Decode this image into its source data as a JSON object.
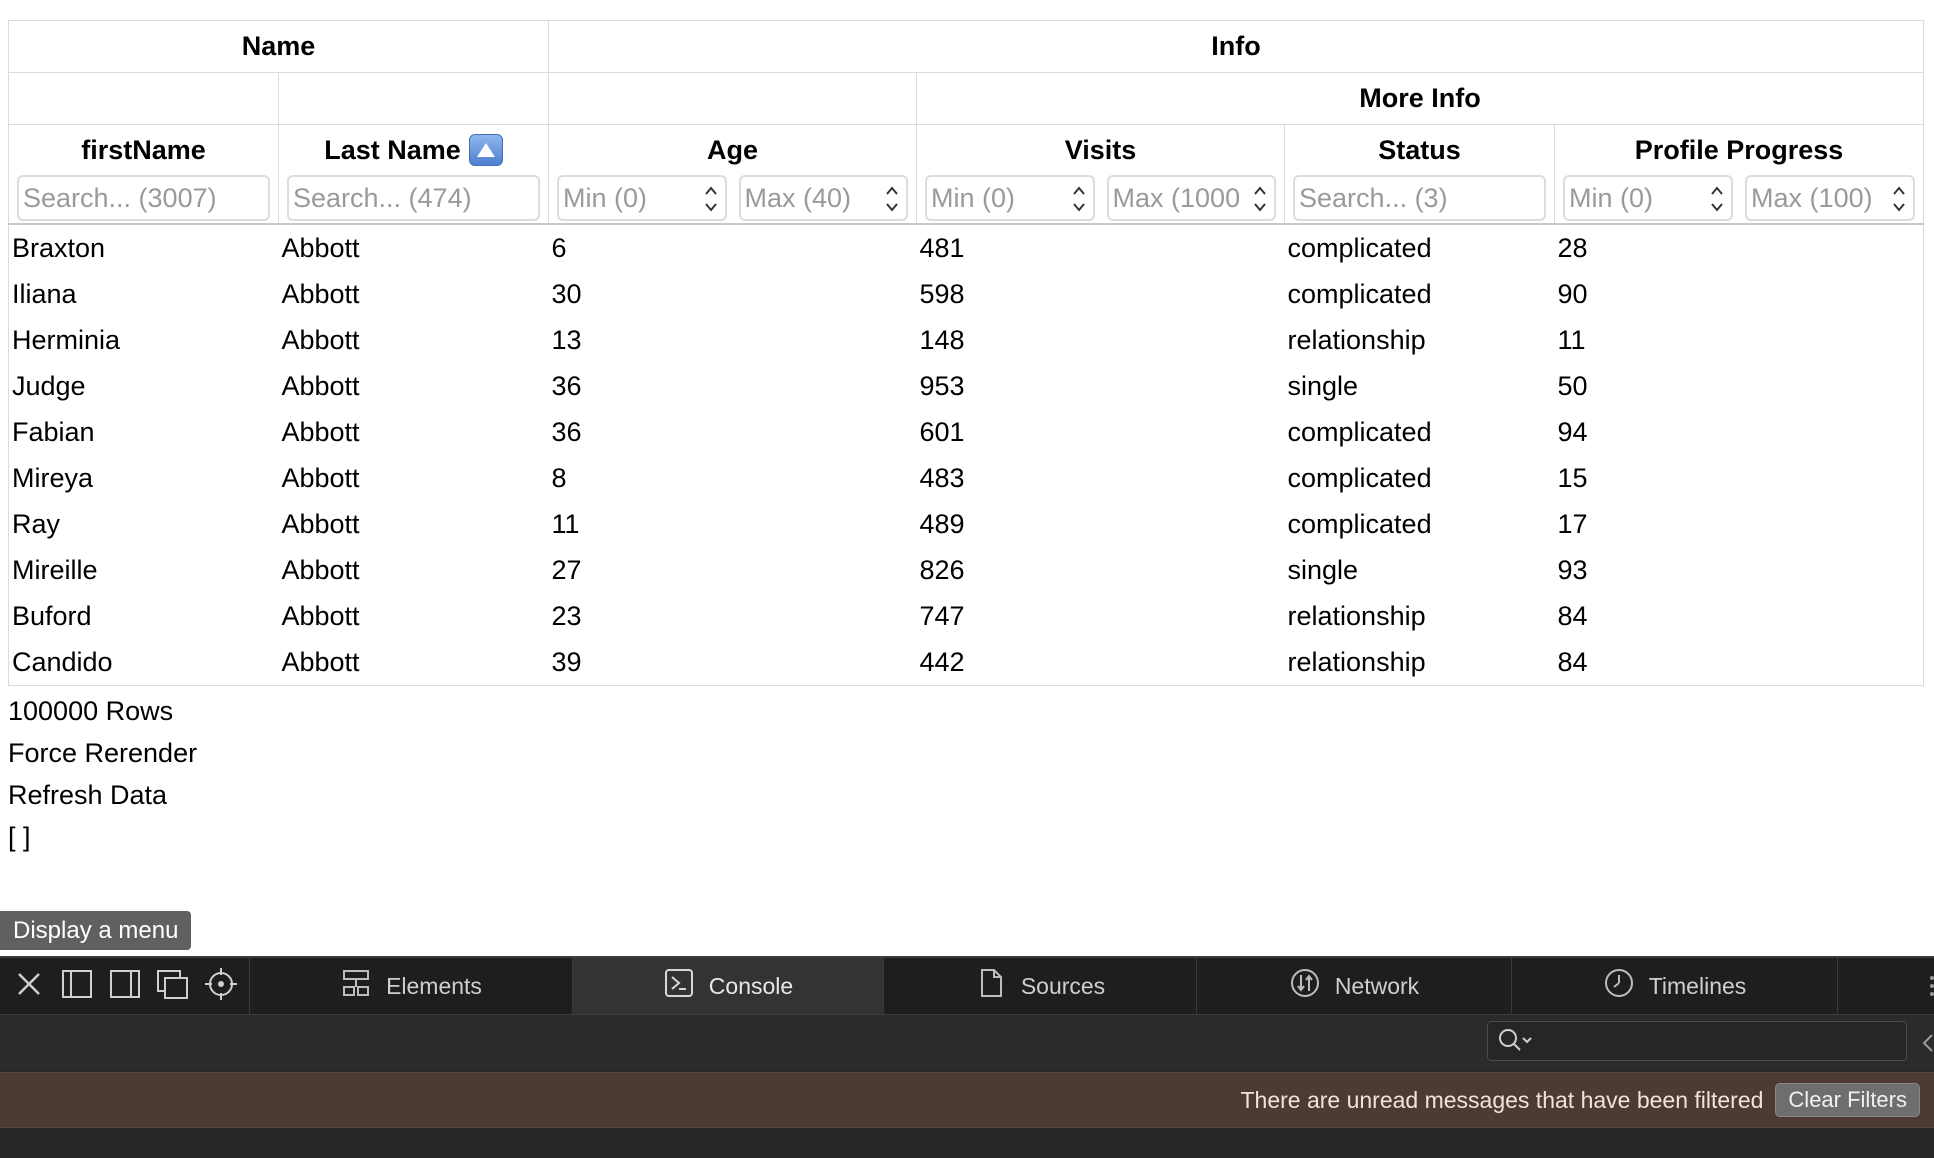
{
  "table": {
    "group_headers": {
      "name": "Name",
      "info": "Info",
      "more_info": "More Info"
    },
    "columns": {
      "first_name": {
        "label": "firstName",
        "placeholder": "Search... (3007)"
      },
      "last_name": {
        "label": "Last Name",
        "placeholder": "Search... (474)",
        "sort": "ascending"
      },
      "age": {
        "label": "Age",
        "min_placeholder": "Min (0)",
        "max_placeholder": "Max (40)"
      },
      "visits": {
        "label": "Visits",
        "min_placeholder": "Min (0)",
        "max_placeholder": "Max (1000"
      },
      "status": {
        "label": "Status",
        "placeholder": "Search... (3)"
      },
      "progress": {
        "label": "Profile Progress",
        "min_placeholder": "Min (0)",
        "max_placeholder": "Max (100)"
      }
    },
    "rows": [
      {
        "first": "Braxton",
        "last": "Abbott",
        "age": "6",
        "visits": "481",
        "status": "complicated",
        "progress": "28"
      },
      {
        "first": "Iliana",
        "last": "Abbott",
        "age": "30",
        "visits": "598",
        "status": "complicated",
        "progress": "90"
      },
      {
        "first": "Herminia",
        "last": "Abbott",
        "age": "13",
        "visits": "148",
        "status": "relationship",
        "progress": "11"
      },
      {
        "first": "Judge",
        "last": "Abbott",
        "age": "36",
        "visits": "953",
        "status": "single",
        "progress": "50"
      },
      {
        "first": "Fabian",
        "last": "Abbott",
        "age": "36",
        "visits": "601",
        "status": "complicated",
        "progress": "94"
      },
      {
        "first": "Mireya",
        "last": "Abbott",
        "age": "8",
        "visits": "483",
        "status": "complicated",
        "progress": "15"
      },
      {
        "first": "Ray",
        "last": "Abbott",
        "age": "11",
        "visits": "489",
        "status": "complicated",
        "progress": "17"
      },
      {
        "first": "Mireille",
        "last": "Abbott",
        "age": "27",
        "visits": "826",
        "status": "single",
        "progress": "93"
      },
      {
        "first": "Buford",
        "last": "Abbott",
        "age": "23",
        "visits": "747",
        "status": "relationship",
        "progress": "84"
      },
      {
        "first": "Candido",
        "last": "Abbott",
        "age": "39",
        "visits": "442",
        "status": "relationship",
        "progress": "84"
      }
    ]
  },
  "below_table": {
    "row_count": "100000 Rows",
    "force_rerender": "Force Rerender",
    "refresh_data": "Refresh Data",
    "state_dump": "[ ]"
  },
  "tooltip": {
    "label": "Display a menu"
  },
  "devtools": {
    "tabs": [
      {
        "label": "Elements",
        "icon": "elements-icon"
      },
      {
        "label": "Console",
        "icon": "console-icon",
        "active": true
      },
      {
        "label": "Sources",
        "icon": "document-icon"
      },
      {
        "label": "Network",
        "icon": "network-icon"
      },
      {
        "label": "Timelines",
        "icon": "clock-icon"
      }
    ],
    "banner_message": "There are unread messages that have been filtered",
    "clear_filters": "Clear Filters"
  }
}
